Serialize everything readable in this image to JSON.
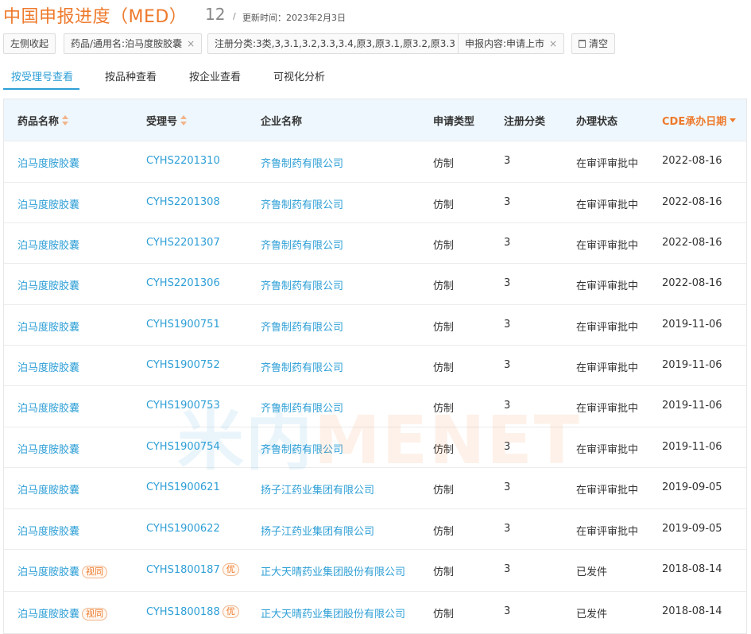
{
  "header": {
    "title": "中国申报进度（MED）",
    "count": "12",
    "separator": "/",
    "update_time": "更新时间：2023年2月3日"
  },
  "filters": {
    "collapse_label": "左侧收起",
    "chips": [
      {
        "label": "药品/通用名:泊马度胺胶囊"
      },
      {
        "label": "注册分类:3类,3,3.1,3.2,3.3,3.4,原3,原3.1,原3.2,原3.3"
      },
      {
        "label": "申报内容:申请上市"
      }
    ],
    "remove_glyph": "×",
    "clear_label": "清空"
  },
  "tabs": [
    {
      "label": "按受理号查看",
      "active": true
    },
    {
      "label": "按品种查看",
      "active": false
    },
    {
      "label": "按企业查看",
      "active": false
    },
    {
      "label": "可视化分析",
      "active": false
    }
  ],
  "table": {
    "columns": [
      "药品名称",
      "受理号",
      "企业名称",
      "申请类型",
      "注册分类",
      "办理状态",
      "CDE承办日期"
    ],
    "rows": [
      {
        "drug": "泊马度胺胶囊",
        "drug_tag": "",
        "acceptance": "CYHS2201310",
        "acc_tag": "",
        "company": "齐鲁制药有限公司",
        "type": "仿制",
        "category": "3",
        "status": "在审评审批中",
        "date": "2022-08-16"
      },
      {
        "drug": "泊马度胺胶囊",
        "drug_tag": "",
        "acceptance": "CYHS2201308",
        "acc_tag": "",
        "company": "齐鲁制药有限公司",
        "type": "仿制",
        "category": "3",
        "status": "在审评审批中",
        "date": "2022-08-16"
      },
      {
        "drug": "泊马度胺胶囊",
        "drug_tag": "",
        "acceptance": "CYHS2201307",
        "acc_tag": "",
        "company": "齐鲁制药有限公司",
        "type": "仿制",
        "category": "3",
        "status": "在审评审批中",
        "date": "2022-08-16"
      },
      {
        "drug": "泊马度胺胶囊",
        "drug_tag": "",
        "acceptance": "CYHS2201306",
        "acc_tag": "",
        "company": "齐鲁制药有限公司",
        "type": "仿制",
        "category": "3",
        "status": "在审评审批中",
        "date": "2022-08-16"
      },
      {
        "drug": "泊马度胺胶囊",
        "drug_tag": "",
        "acceptance": "CYHS1900751",
        "acc_tag": "",
        "company": "齐鲁制药有限公司",
        "type": "仿制",
        "category": "3",
        "status": "在审评审批中",
        "date": "2019-11-06"
      },
      {
        "drug": "泊马度胺胶囊",
        "drug_tag": "",
        "acceptance": "CYHS1900752",
        "acc_tag": "",
        "company": "齐鲁制药有限公司",
        "type": "仿制",
        "category": "3",
        "status": "在审评审批中",
        "date": "2019-11-06"
      },
      {
        "drug": "泊马度胺胶囊",
        "drug_tag": "",
        "acceptance": "CYHS1900753",
        "acc_tag": "",
        "company": "齐鲁制药有限公司",
        "type": "仿制",
        "category": "3",
        "status": "在审评审批中",
        "date": "2019-11-06"
      },
      {
        "drug": "泊马度胺胶囊",
        "drug_tag": "",
        "acceptance": "CYHS1900754",
        "acc_tag": "",
        "company": "齐鲁制药有限公司",
        "type": "仿制",
        "category": "3",
        "status": "在审评审批中",
        "date": "2019-11-06"
      },
      {
        "drug": "泊马度胺胶囊",
        "drug_tag": "",
        "acceptance": "CYHS1900621",
        "acc_tag": "",
        "company": "扬子江药业集团有限公司",
        "type": "仿制",
        "category": "3",
        "status": "在审评审批中",
        "date": "2019-09-05"
      },
      {
        "drug": "泊马度胺胶囊",
        "drug_tag": "",
        "acceptance": "CYHS1900622",
        "acc_tag": "",
        "company": "扬子江药业集团有限公司",
        "type": "仿制",
        "category": "3",
        "status": "在审评审批中",
        "date": "2019-09-05"
      },
      {
        "drug": "泊马度胺胶囊",
        "drug_tag": "视同",
        "acceptance": "CYHS1800187",
        "acc_tag": "优",
        "company": "正大天晴药业集团股份有限公司",
        "type": "仿制",
        "category": "3",
        "status": "已发件",
        "date": "2018-08-14"
      },
      {
        "drug": "泊马度胺胶囊",
        "drug_tag": "视同",
        "acceptance": "CYHS1800188",
        "acc_tag": "优",
        "company": "正大天晴药业集团股份有限公司",
        "type": "仿制",
        "category": "3",
        "status": "已发件",
        "date": "2018-08-14"
      }
    ]
  },
  "watermark": {
    "cn": "米内",
    "en": "MENET"
  },
  "colors": {
    "accent": "#ee7a2c",
    "link": "#2e9fd6",
    "header_bg": "#eef7fd"
  }
}
